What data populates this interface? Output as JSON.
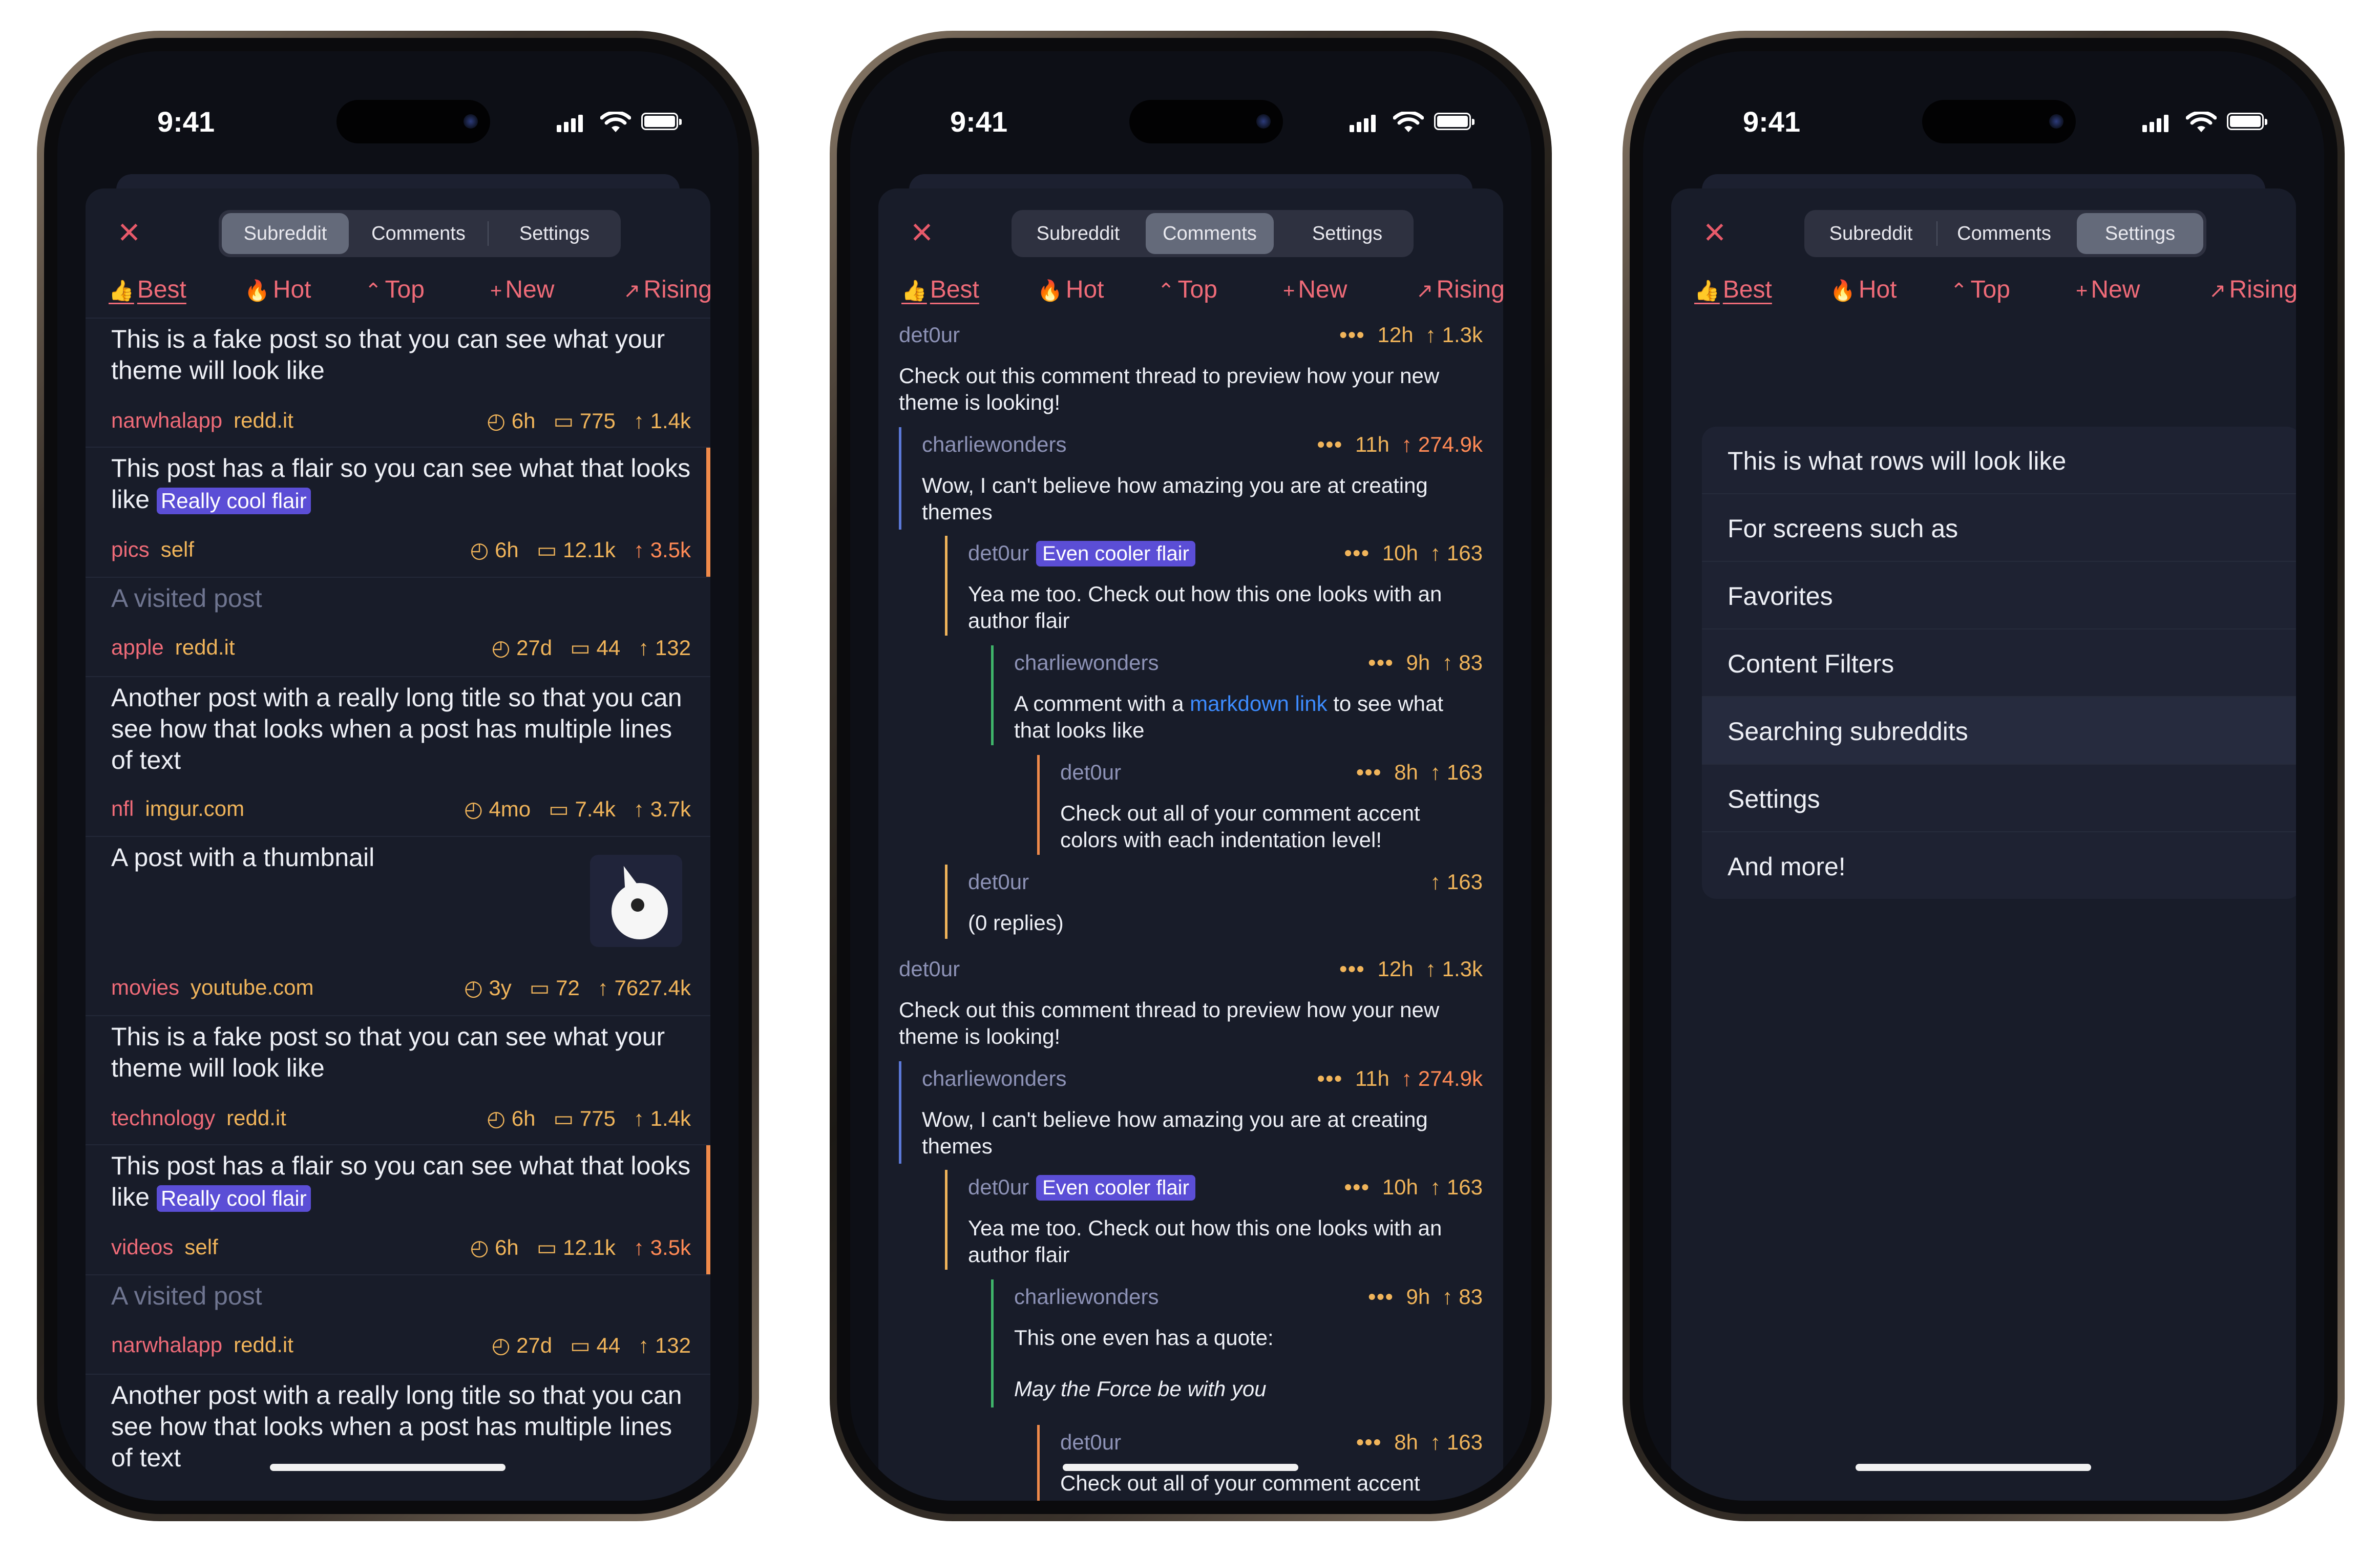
{
  "status": {
    "time": "9:41"
  },
  "segments": [
    "Subreddit",
    "Comments",
    "Settings"
  ],
  "sorts": [
    {
      "icon": "👍",
      "label": "Best"
    },
    {
      "icon": "🔥",
      "label": "Hot"
    },
    {
      "icon": "⌃",
      "label": "Top"
    },
    {
      "icon": "+",
      "label": "New"
    },
    {
      "icon": "↗",
      "label": "Rising"
    }
  ],
  "posts": [
    {
      "title": "This is a fake post so that you can see what your theme will look like",
      "subreddit": "narwhalapp",
      "domain": "redd.it",
      "age": "6h",
      "comments": "775",
      "score": "1.4k"
    },
    {
      "title": "This post has a flair so you can see what that looks like",
      "flair": "Really cool flair",
      "subreddit": "pics",
      "domain": "self",
      "age": "6h",
      "comments": "12.1k",
      "score": "3.5k"
    },
    {
      "title": "A visited post",
      "subreddit": "apple",
      "domain": "redd.it",
      "age": "27d",
      "comments": "44",
      "score": "132"
    },
    {
      "title": "Another post with a really long title so that you can see how that looks when a post has multiple lines of text",
      "subreddit": "nfl",
      "domain": "imgur.com",
      "age": "4mo",
      "comments": "7.4k",
      "score": "3.7k"
    },
    {
      "title": "A post with a thumbnail",
      "subreddit": "movies",
      "domain": "youtube.com",
      "age": "3y",
      "comments": "72",
      "score": "7627.4k"
    },
    {
      "title": "This is a fake post so that you can see what your theme will look like",
      "subreddit": "technology",
      "domain": "redd.it",
      "age": "6h",
      "comments": "775",
      "score": "1.4k"
    },
    {
      "title": "This post has a flair so you can see what that looks like",
      "flair": "Really cool flair",
      "subreddit": "videos",
      "domain": "self",
      "age": "6h",
      "comments": "12.1k",
      "score": "3.5k"
    },
    {
      "title": "A visited post",
      "subreddit": "narwhalapp",
      "domain": "redd.it",
      "age": "27d",
      "comments": "44",
      "score": "132"
    },
    {
      "title": "Another post with a really long title so that you can see how that looks when a post has multiple lines of text"
    }
  ],
  "comments": [
    {
      "author": "det0ur",
      "age": "12h",
      "score": "1.3k",
      "text": "Check out this comment thread to preview how your new theme is looking!"
    },
    {
      "author": "charliewonders",
      "age": "11h",
      "score": "274.9k",
      "text": "Wow, I can't believe how amazing you are at creating themes"
    },
    {
      "author": "det0ur",
      "flair": "Even cooler flair",
      "age": "10h",
      "score": "163",
      "text": "Yea me too. Check out how this one looks with an author flair"
    },
    {
      "author": "charliewonders",
      "age": "9h",
      "score": "83",
      "text_pre": "A comment with a ",
      "link": "markdown link",
      "text_post": " to see what that looks like"
    },
    {
      "author": "det0ur",
      "age": "8h",
      "score": "163",
      "text": "Check out all of your comment accent colors with each indentation level!"
    },
    {
      "author": "det0ur",
      "score": "163",
      "text": "(0 replies)"
    },
    {
      "author": "det0ur",
      "age": "12h",
      "score": "1.3k",
      "text": "Check out this comment thread to preview how your new theme is looking!"
    },
    {
      "author": "charliewonders",
      "age": "11h",
      "score": "274.9k",
      "text": "Wow, I can't believe how amazing you are at creating themes"
    },
    {
      "author": "det0ur",
      "flair": "Even cooler flair",
      "age": "10h",
      "score": "163",
      "text": "Yea me too. Check out how this one looks with an author flair"
    },
    {
      "author": "charliewonders",
      "age": "9h",
      "score": "83",
      "text": "This one even has a quote:",
      "quote": "May the Force be with you"
    },
    {
      "author": "det0ur",
      "age": "8h",
      "score": "163",
      "text": "Check out all of your comment accent colors with"
    }
  ],
  "settings_rows": [
    "This is what rows will look like",
    "For screens such as",
    "Favorites",
    "Content Filters",
    "Searching subreddits",
    "Settings",
    "And more!"
  ],
  "icons": {
    "clock": "clock-icon",
    "comment": "comment-bubble-icon",
    "upvote": "arrow-up-icon",
    "close": "close-icon"
  },
  "colors": {
    "accent": "#ef6b78",
    "secondary": "#f0b45a",
    "flair": "#5b4ed6",
    "background": "#181c29",
    "link": "#3d8cff"
  }
}
